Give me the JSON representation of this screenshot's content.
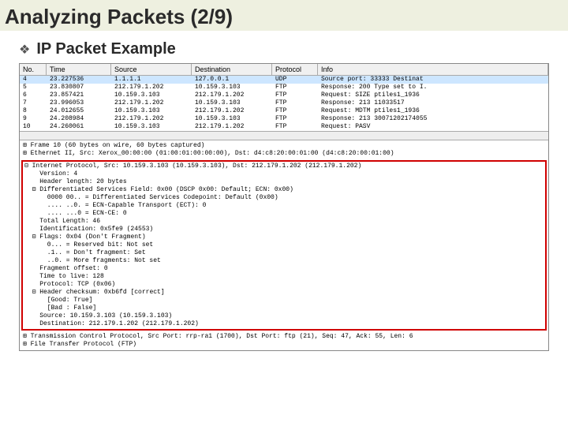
{
  "title": "Analyzing Packets (2/9)",
  "subtitle": "IP Packet Example",
  "headers": {
    "no": "No.",
    "time": "Time",
    "src": "Source",
    "dst": "Destination",
    "proto": "Protocol",
    "info": "Info"
  },
  "rows": [
    {
      "no": "4",
      "time": "23.227536",
      "src": "1.1.1.1",
      "dst": "127.0.0.1",
      "proto": "UDP",
      "info": "Source port: 33333   Destinat"
    },
    {
      "no": "5",
      "time": "23.830807",
      "src": "212.179.1.202",
      "dst": "10.159.3.103",
      "proto": "FTP",
      "info": "Response: 200 Type set to I."
    },
    {
      "no": "6",
      "time": "23.857421",
      "src": "10.159.3.103",
      "dst": "212.179.1.202",
      "proto": "FTP",
      "info": "Request: SIZE ptiles1_1936"
    },
    {
      "no": "7",
      "time": "23.996053",
      "src": "212.179.1.202",
      "dst": "10.159.3.103",
      "proto": "FTP",
      "info": "Response: 213 11033517"
    },
    {
      "no": "8",
      "time": "24.012655",
      "src": "10.159.3.103",
      "dst": "212.179.1.202",
      "proto": "FTP",
      "info": "Request: MDTM ptiles1_1936"
    },
    {
      "no": "9",
      "time": "24.208984",
      "src": "212.179.1.202",
      "dst": "10.159.3.103",
      "proto": "FTP",
      "info": "Response: 213 30071202174055"
    },
    {
      "no": "10",
      "time": "24.260061",
      "src": "10.159.3.103",
      "dst": "212.179.1.202",
      "proto": "FTP",
      "info": "Request: PASV"
    }
  ],
  "detail_top": [
    "⊞ Frame 10 (60 bytes on wire, 60 bytes captured)",
    "⊞ Ethernet II, Src: Xerox_00:00:00 (01:00:01:00:00:00), Dst: d4:c8:20:00:01:00 (d4:c8:20:00:01:00)"
  ],
  "redbox": [
    "⊟ Internet Protocol, Src: 10.159.3.103 (10.159.3.103), Dst: 212.179.1.202 (212.179.1.202)",
    "    Version: 4",
    "    Header length: 20 bytes",
    "  ⊟ Differentiated Services Field: 0x00 (DSCP 0x00: Default; ECN: 0x00)",
    "      0000 00.. = Differentiated Services Codepoint: Default (0x00)",
    "      .... ..0. = ECN-Capable Transport (ECT): 0",
    "      .... ...0 = ECN-CE: 0",
    "    Total Length: 46",
    "    Identification: 0x5fe9 (24553)",
    "  ⊟ Flags: 0x04 (Don't Fragment)",
    "      0... = Reserved bit: Not set",
    "      .1.. = Don't fragment: Set",
    "      ..0. = More fragments: Not set",
    "    Fragment offset: 0",
    "    Time to live: 128",
    "    Protocol: TCP (0x06)",
    "  ⊟ Header checksum: 0xb6fd [correct]",
    "      [Good: True]",
    "      [Bad : False]",
    "    Source: 10.159.3.103 (10.159.3.103)",
    "    Destination: 212.179.1.202 (212.179.1.202)"
  ],
  "detail_bottom": [
    "⊞ Transmission Control Protocol, Src Port: rrp-ra1 (1700), Dst Port: ftp (21), Seq: 47, Ack: 55, Len: 6",
    "⊞ File Transfer Protocol (FTP)"
  ]
}
